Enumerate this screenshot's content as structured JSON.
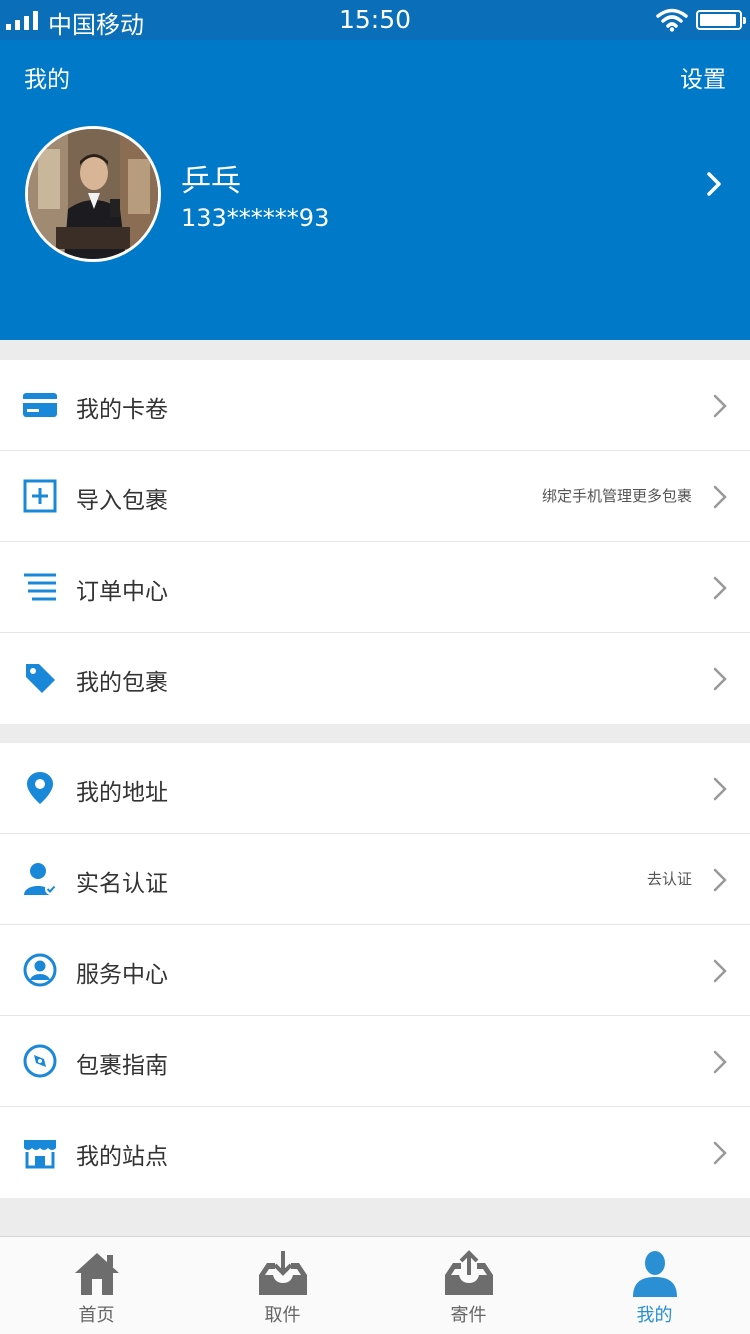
{
  "status_bar": {
    "carrier": "中国移动",
    "time": "15:50"
  },
  "header": {
    "title": "我的",
    "settings_label": "设置"
  },
  "profile": {
    "nickname": "乒乓",
    "phone": "133******93"
  },
  "menu_group_1": [
    {
      "label": "我的卡卷",
      "icon": "card-icon",
      "hint": ""
    },
    {
      "label": "导入包裹",
      "icon": "plus-box-icon",
      "hint": "绑定手机管理更多包裹"
    },
    {
      "label": "订单中心",
      "icon": "list-icon",
      "hint": ""
    },
    {
      "label": "我的包裹",
      "icon": "tag-icon",
      "hint": ""
    }
  ],
  "menu_group_2": [
    {
      "label": "我的地址",
      "icon": "location-pin-icon",
      "hint": ""
    },
    {
      "label": "实名认证",
      "icon": "verified-user-icon",
      "hint": "去认证"
    },
    {
      "label": "服务中心",
      "icon": "user-circle-icon",
      "hint": ""
    },
    {
      "label": "包裹指南",
      "icon": "compass-icon",
      "hint": ""
    },
    {
      "label": "我的站点",
      "icon": "store-icon",
      "hint": ""
    }
  ],
  "tab_bar": [
    {
      "label": "首页",
      "icon": "home-icon",
      "active": false
    },
    {
      "label": "取件",
      "icon": "inbox-download-icon",
      "active": false
    },
    {
      "label": "寄件",
      "icon": "inbox-upload-icon",
      "active": false
    },
    {
      "label": "我的",
      "icon": "person-icon",
      "active": true
    }
  ],
  "colors": {
    "header_bg": "#0079c9",
    "status_bg": "#0a6fb8",
    "accent": "#1a88d8",
    "tab_active": "#2b8fd4",
    "tab_inactive": "#666666"
  }
}
